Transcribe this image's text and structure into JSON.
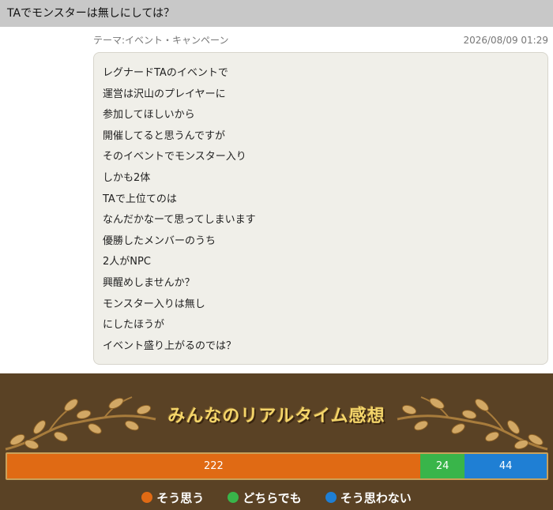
{
  "thread": {
    "title": "TAでモンスターは無しにしては？"
  },
  "post": {
    "theme": "テーマ:イベント・キャンペーン",
    "date": "2026/08/09 01:29",
    "lines": [
      "レグナードTAのイベントで",
      "運営は沢山のプレイヤーに",
      "参加してほしいから",
      "開催してると思うんですが",
      "そのイベントでモンスター入り",
      "しかも2体",
      "TAで上位てのは",
      "なんだかなーて思ってしまいます",
      "優勝したメンバーのうち",
      "2人がNPC",
      "興醒めしませんか？",
      "モンスター入りは無し",
      "にしたほうが",
      "イベント盛り上がるのでは？"
    ]
  },
  "vote": {
    "title": "みんなのリアルタイム感想",
    "results": [
      {
        "key": "agree",
        "label": "そう思う",
        "count": 222,
        "color": "#e06a14"
      },
      {
        "key": "neutral",
        "label": "どちらでも",
        "count": 24,
        "color": "#39b54a"
      },
      {
        "key": "disagree",
        "label": "そう思わない",
        "count": 44,
        "color": "#1f7fd4"
      }
    ],
    "decoration_icon": "leafy-vine-icon"
  }
}
